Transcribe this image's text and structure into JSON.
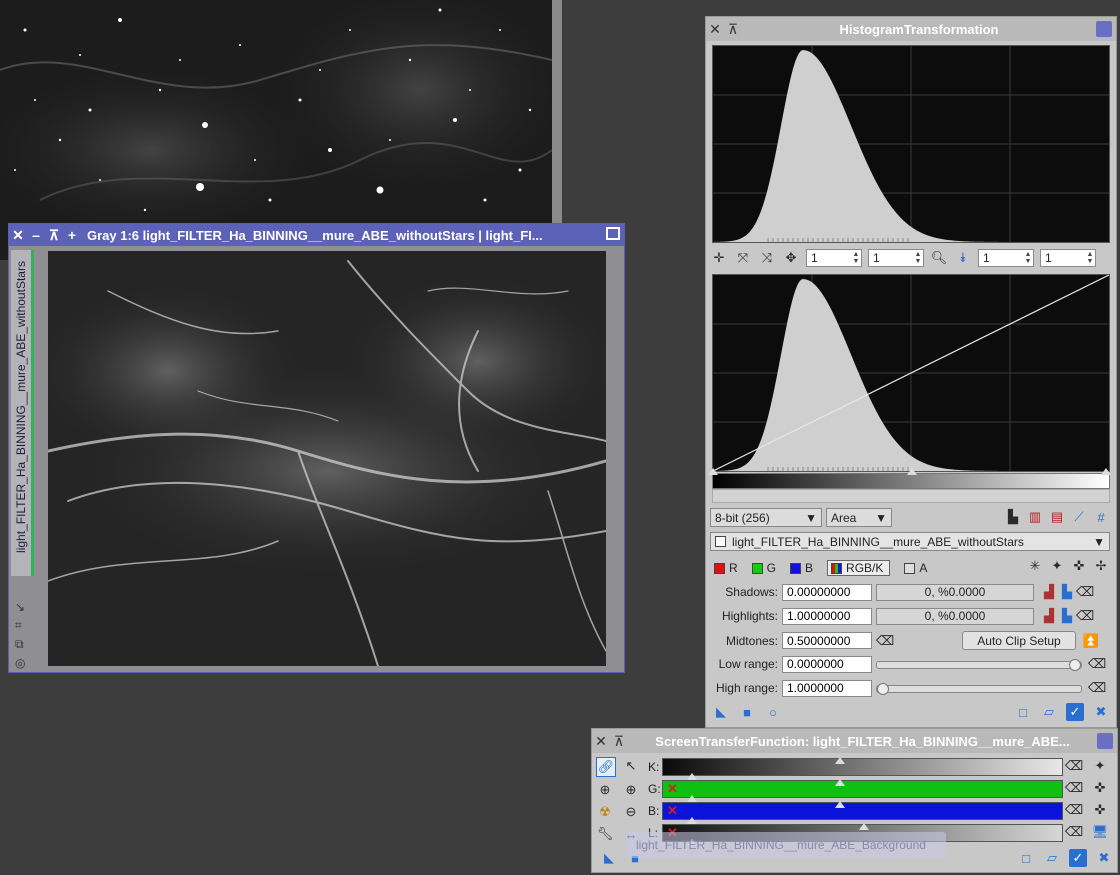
{
  "image_window": {
    "title": "Gray 1:6 light_FILTER_Ha_BINNING__mure_ABE_withoutStars | light_FI...",
    "side_label": "light_FILTER_Ha_BINNING__mure_ABE_withoutStars"
  },
  "histogram": {
    "title": "HistogramTransformation",
    "zoom_values": [
      "1",
      "1",
      "1",
      "1"
    ],
    "resolution": "8-bit (256)",
    "graph_style": "Area",
    "view_target": "light_FILTER_Ha_BINNING__mure_ABE_withoutStars",
    "channels": [
      {
        "label": "R",
        "color": "#dd1111"
      },
      {
        "label": "G",
        "color": "#11cc11"
      },
      {
        "label": "B",
        "color": "#1111dd"
      },
      {
        "label": "RGB/K",
        "color": "#666666"
      },
      {
        "label": "A",
        "color": "#bbbbbb"
      }
    ],
    "shadows": {
      "label": "Shadows:",
      "value": "0.00000000",
      "clip": "0, %0.0000"
    },
    "highlights": {
      "label": "Highlights:",
      "value": "1.00000000",
      "clip": "0, %0.0000"
    },
    "midtones": {
      "label": "Midtones:",
      "value": "0.50000000"
    },
    "auto_clip_label": "Auto Clip Setup",
    "low_range": {
      "label": "Low range:",
      "value": "0.0000000",
      "level": 1.0
    },
    "high_range": {
      "label": "High range:",
      "value": "1.0000000",
      "level": 0.0
    }
  },
  "stf": {
    "title": "ScreenTransferFunction: light_FILTER_Ha_BINNING__mure_ABE...",
    "channels": [
      {
        "label": "K:",
        "color": "#808080"
      },
      {
        "label": "G:",
        "color": "#10c010"
      },
      {
        "label": "B:",
        "color": "#0a14d8"
      },
      {
        "label": "L:",
        "color": "#b0b0b0"
      }
    ],
    "tooltip": "light_FILTER_Ha_BINNING__mure_ABE_Background"
  }
}
